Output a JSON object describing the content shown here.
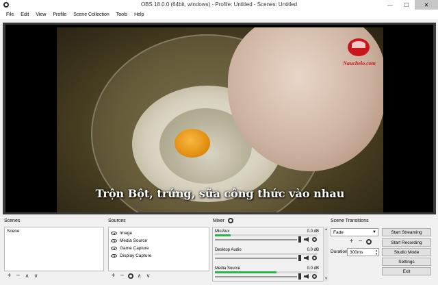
{
  "window": {
    "title": "OBS 18.0.0 (64bit, windows) - Profile: Untitled - Scenes: Untitled",
    "minimize": "—",
    "maximize": "☐",
    "close": "✕"
  },
  "menu": [
    "File",
    "Edit",
    "View",
    "Profile",
    "Scene Collection",
    "Tools",
    "Help"
  ],
  "preview": {
    "subtitle": "Trộn Bột, trứng, sữa công thức vào nhau",
    "watermark": "Nauchelo.com"
  },
  "scenes": {
    "title": "Scenes",
    "items": [
      "Scene"
    ]
  },
  "sources": {
    "title": "Sources",
    "items": [
      "Image",
      "Media Source",
      "Game Capture",
      "Display Capture"
    ]
  },
  "mixer": {
    "title": "Mixer",
    "channels": [
      {
        "name": "Mic/Aux",
        "db": "0.0 dB",
        "level": 0.15
      },
      {
        "name": "Desktop Audio",
        "db": "0.0 dB",
        "level": 0.0
      },
      {
        "name": "Media Source",
        "db": "0.0 dB",
        "level": 0.6
      }
    ]
  },
  "transitions": {
    "title": "Scene Transitions",
    "selected": "Fade",
    "duration_label": "Duration",
    "duration_value": "300ms"
  },
  "controls": {
    "start_streaming": "Start Streaming",
    "start_recording": "Start Recording",
    "studio_mode": "Studio Mode",
    "settings": "Settings",
    "exit": "Exit"
  },
  "toolbar_glyphs": {
    "add": "+",
    "remove": "−",
    "up": "∧",
    "down": "∨"
  },
  "colors": {
    "meter_green": "#2db34a",
    "logo_red": "#c8161d"
  }
}
